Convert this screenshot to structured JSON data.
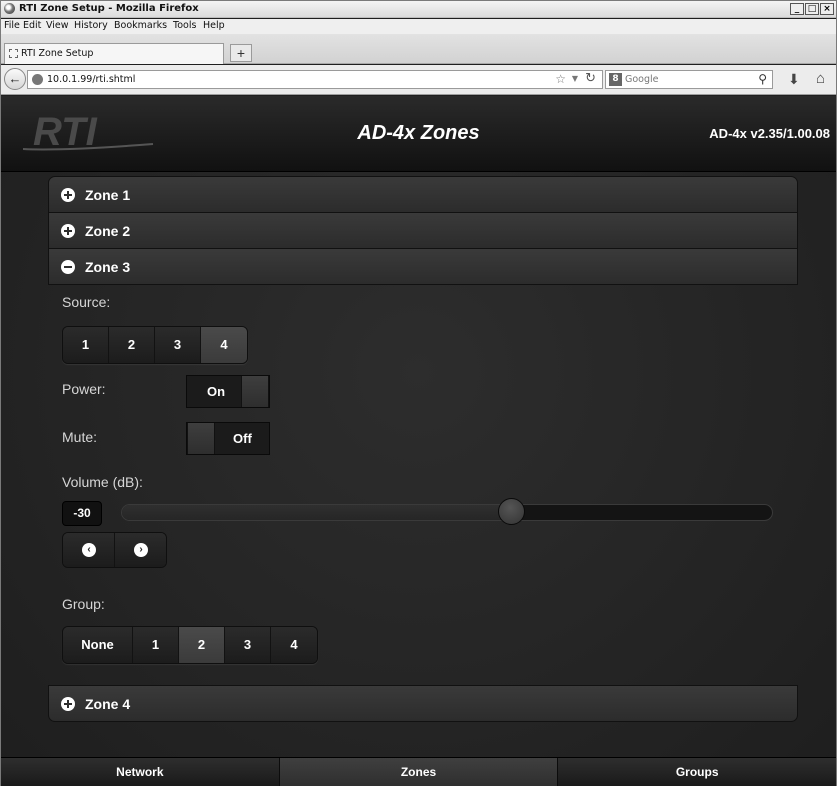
{
  "window": {
    "title": "RTI Zone Setup - Mozilla Firefox",
    "controls": {
      "minimize": "_",
      "maximize": "□",
      "close": "×"
    }
  },
  "menubar": [
    "File",
    "Edit",
    "View",
    "History",
    "Bookmarks",
    "Tools",
    "Help"
  ],
  "tab": {
    "label": "RTI Zone Setup",
    "new_tab": "+"
  },
  "navbar": {
    "url": "10.0.1.99/rti.shtml",
    "search_engine": "Google",
    "icons": {
      "back": "back-arrow-icon",
      "star": "bookmark-star-icon",
      "reload": "reload-icon",
      "download": "download-icon",
      "home": "home-icon",
      "search": "magnifier-icon"
    }
  },
  "app": {
    "logo_text": "RTI",
    "title": "AD-4x Zones",
    "version": "AD-4x v2.35/1.00.08"
  },
  "zones": [
    {
      "label": "Zone 1",
      "state": "collapsed"
    },
    {
      "label": "Zone 2",
      "state": "collapsed"
    },
    {
      "label": "Zone 3",
      "state": "expanded"
    },
    {
      "label": "Zone 4",
      "state": "collapsed"
    }
  ],
  "zone3": {
    "source": {
      "label": "Source:",
      "options": [
        "1",
        "2",
        "3",
        "4"
      ],
      "selected": "4"
    },
    "power": {
      "label": "Power:",
      "value": "On",
      "on": true
    },
    "mute": {
      "label": "Mute:",
      "value": "Off",
      "on": false
    },
    "volume": {
      "label": "Volume (dB):",
      "value": "-30",
      "level": 0.6,
      "decrease": "‹",
      "increase": "›"
    },
    "group": {
      "label": "Group:",
      "options": [
        "None",
        "1",
        "2",
        "3",
        "4"
      ],
      "selected": "2"
    }
  },
  "bottom_nav": [
    {
      "label": "Network",
      "active": false
    },
    {
      "label": "Zones",
      "active": true
    },
    {
      "label": "Groups",
      "active": false
    }
  ],
  "colors": {
    "background": "#242424",
    "header": "#111111",
    "text": "#ffffff",
    "label": "#d6d6d6",
    "active_segment": "#444444"
  }
}
